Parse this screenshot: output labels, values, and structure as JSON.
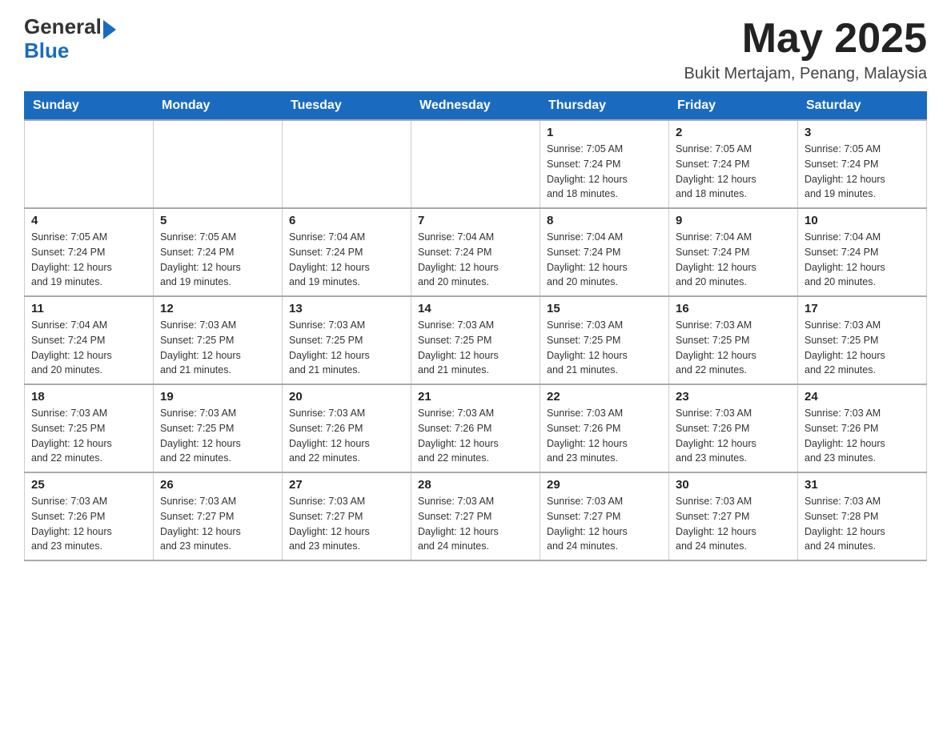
{
  "header": {
    "logo_general": "General",
    "logo_blue": "Blue",
    "month_title": "May 2025",
    "location": "Bukit Mertajam, Penang, Malaysia"
  },
  "weekdays": [
    "Sunday",
    "Monday",
    "Tuesday",
    "Wednesday",
    "Thursday",
    "Friday",
    "Saturday"
  ],
  "weeks": [
    [
      {
        "day": "",
        "info": ""
      },
      {
        "day": "",
        "info": ""
      },
      {
        "day": "",
        "info": ""
      },
      {
        "day": "",
        "info": ""
      },
      {
        "day": "1",
        "info": "Sunrise: 7:05 AM\nSunset: 7:24 PM\nDaylight: 12 hours\nand 18 minutes."
      },
      {
        "day": "2",
        "info": "Sunrise: 7:05 AM\nSunset: 7:24 PM\nDaylight: 12 hours\nand 18 minutes."
      },
      {
        "day": "3",
        "info": "Sunrise: 7:05 AM\nSunset: 7:24 PM\nDaylight: 12 hours\nand 19 minutes."
      }
    ],
    [
      {
        "day": "4",
        "info": "Sunrise: 7:05 AM\nSunset: 7:24 PM\nDaylight: 12 hours\nand 19 minutes."
      },
      {
        "day": "5",
        "info": "Sunrise: 7:05 AM\nSunset: 7:24 PM\nDaylight: 12 hours\nand 19 minutes."
      },
      {
        "day": "6",
        "info": "Sunrise: 7:04 AM\nSunset: 7:24 PM\nDaylight: 12 hours\nand 19 minutes."
      },
      {
        "day": "7",
        "info": "Sunrise: 7:04 AM\nSunset: 7:24 PM\nDaylight: 12 hours\nand 20 minutes."
      },
      {
        "day": "8",
        "info": "Sunrise: 7:04 AM\nSunset: 7:24 PM\nDaylight: 12 hours\nand 20 minutes."
      },
      {
        "day": "9",
        "info": "Sunrise: 7:04 AM\nSunset: 7:24 PM\nDaylight: 12 hours\nand 20 minutes."
      },
      {
        "day": "10",
        "info": "Sunrise: 7:04 AM\nSunset: 7:24 PM\nDaylight: 12 hours\nand 20 minutes."
      }
    ],
    [
      {
        "day": "11",
        "info": "Sunrise: 7:04 AM\nSunset: 7:24 PM\nDaylight: 12 hours\nand 20 minutes."
      },
      {
        "day": "12",
        "info": "Sunrise: 7:03 AM\nSunset: 7:25 PM\nDaylight: 12 hours\nand 21 minutes."
      },
      {
        "day": "13",
        "info": "Sunrise: 7:03 AM\nSunset: 7:25 PM\nDaylight: 12 hours\nand 21 minutes."
      },
      {
        "day": "14",
        "info": "Sunrise: 7:03 AM\nSunset: 7:25 PM\nDaylight: 12 hours\nand 21 minutes."
      },
      {
        "day": "15",
        "info": "Sunrise: 7:03 AM\nSunset: 7:25 PM\nDaylight: 12 hours\nand 21 minutes."
      },
      {
        "day": "16",
        "info": "Sunrise: 7:03 AM\nSunset: 7:25 PM\nDaylight: 12 hours\nand 22 minutes."
      },
      {
        "day": "17",
        "info": "Sunrise: 7:03 AM\nSunset: 7:25 PM\nDaylight: 12 hours\nand 22 minutes."
      }
    ],
    [
      {
        "day": "18",
        "info": "Sunrise: 7:03 AM\nSunset: 7:25 PM\nDaylight: 12 hours\nand 22 minutes."
      },
      {
        "day": "19",
        "info": "Sunrise: 7:03 AM\nSunset: 7:25 PM\nDaylight: 12 hours\nand 22 minutes."
      },
      {
        "day": "20",
        "info": "Sunrise: 7:03 AM\nSunset: 7:26 PM\nDaylight: 12 hours\nand 22 minutes."
      },
      {
        "day": "21",
        "info": "Sunrise: 7:03 AM\nSunset: 7:26 PM\nDaylight: 12 hours\nand 22 minutes."
      },
      {
        "day": "22",
        "info": "Sunrise: 7:03 AM\nSunset: 7:26 PM\nDaylight: 12 hours\nand 23 minutes."
      },
      {
        "day": "23",
        "info": "Sunrise: 7:03 AM\nSunset: 7:26 PM\nDaylight: 12 hours\nand 23 minutes."
      },
      {
        "day": "24",
        "info": "Sunrise: 7:03 AM\nSunset: 7:26 PM\nDaylight: 12 hours\nand 23 minutes."
      }
    ],
    [
      {
        "day": "25",
        "info": "Sunrise: 7:03 AM\nSunset: 7:26 PM\nDaylight: 12 hours\nand 23 minutes."
      },
      {
        "day": "26",
        "info": "Sunrise: 7:03 AM\nSunset: 7:27 PM\nDaylight: 12 hours\nand 23 minutes."
      },
      {
        "day": "27",
        "info": "Sunrise: 7:03 AM\nSunset: 7:27 PM\nDaylight: 12 hours\nand 23 minutes."
      },
      {
        "day": "28",
        "info": "Sunrise: 7:03 AM\nSunset: 7:27 PM\nDaylight: 12 hours\nand 24 minutes."
      },
      {
        "day": "29",
        "info": "Sunrise: 7:03 AM\nSunset: 7:27 PM\nDaylight: 12 hours\nand 24 minutes."
      },
      {
        "day": "30",
        "info": "Sunrise: 7:03 AM\nSunset: 7:27 PM\nDaylight: 12 hours\nand 24 minutes."
      },
      {
        "day": "31",
        "info": "Sunrise: 7:03 AM\nSunset: 7:28 PM\nDaylight: 12 hours\nand 24 minutes."
      }
    ]
  ]
}
